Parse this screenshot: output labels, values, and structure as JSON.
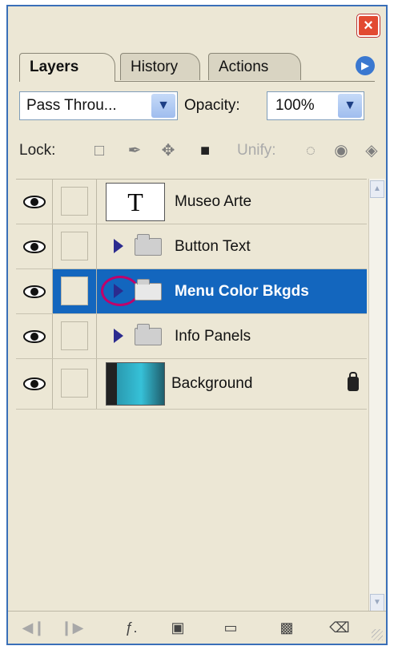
{
  "window": {
    "close_label": "×"
  },
  "tabs": [
    {
      "label": "Layers",
      "active": true
    },
    {
      "label": "History",
      "active": false
    },
    {
      "label": "Actions",
      "active": false
    }
  ],
  "palette_menu_icon": "palette-menu-icon",
  "blend_mode": {
    "value": "Pass Throu...",
    "dropdown_icon": "chevron-down-icon"
  },
  "opacity": {
    "label": "Opacity:",
    "value": "100%"
  },
  "lock": {
    "label": "Lock:",
    "icons": [
      "lock-transparent-icon",
      "lock-image-icon",
      "lock-position-icon",
      "lock-all-icon"
    ]
  },
  "unify": {
    "label": "Unify:",
    "icons": [
      "unify-position-icon",
      "unify-visibility-icon",
      "unify-style-icon"
    ]
  },
  "layers": [
    {
      "name": "Museo Arte",
      "type": "text",
      "thumb_text": "T"
    },
    {
      "name": "Button Text",
      "type": "group"
    },
    {
      "name": "Menu Color Bkgds",
      "type": "group",
      "selected": true
    },
    {
      "name": "Info Panels",
      "type": "group"
    },
    {
      "name": "Background",
      "type": "image",
      "locked": true
    }
  ],
  "bottom_bar_icons": [
    "prev-frame-icon",
    "next-frame-icon",
    "layer-style-icon",
    "layer-mask-icon",
    "new-group-icon",
    "new-layer-icon",
    "delete-layer-icon"
  ],
  "colors": {
    "selection": "#1366be",
    "highlight_circle": "#c0006a",
    "panel_bg": "#ece7d5"
  }
}
